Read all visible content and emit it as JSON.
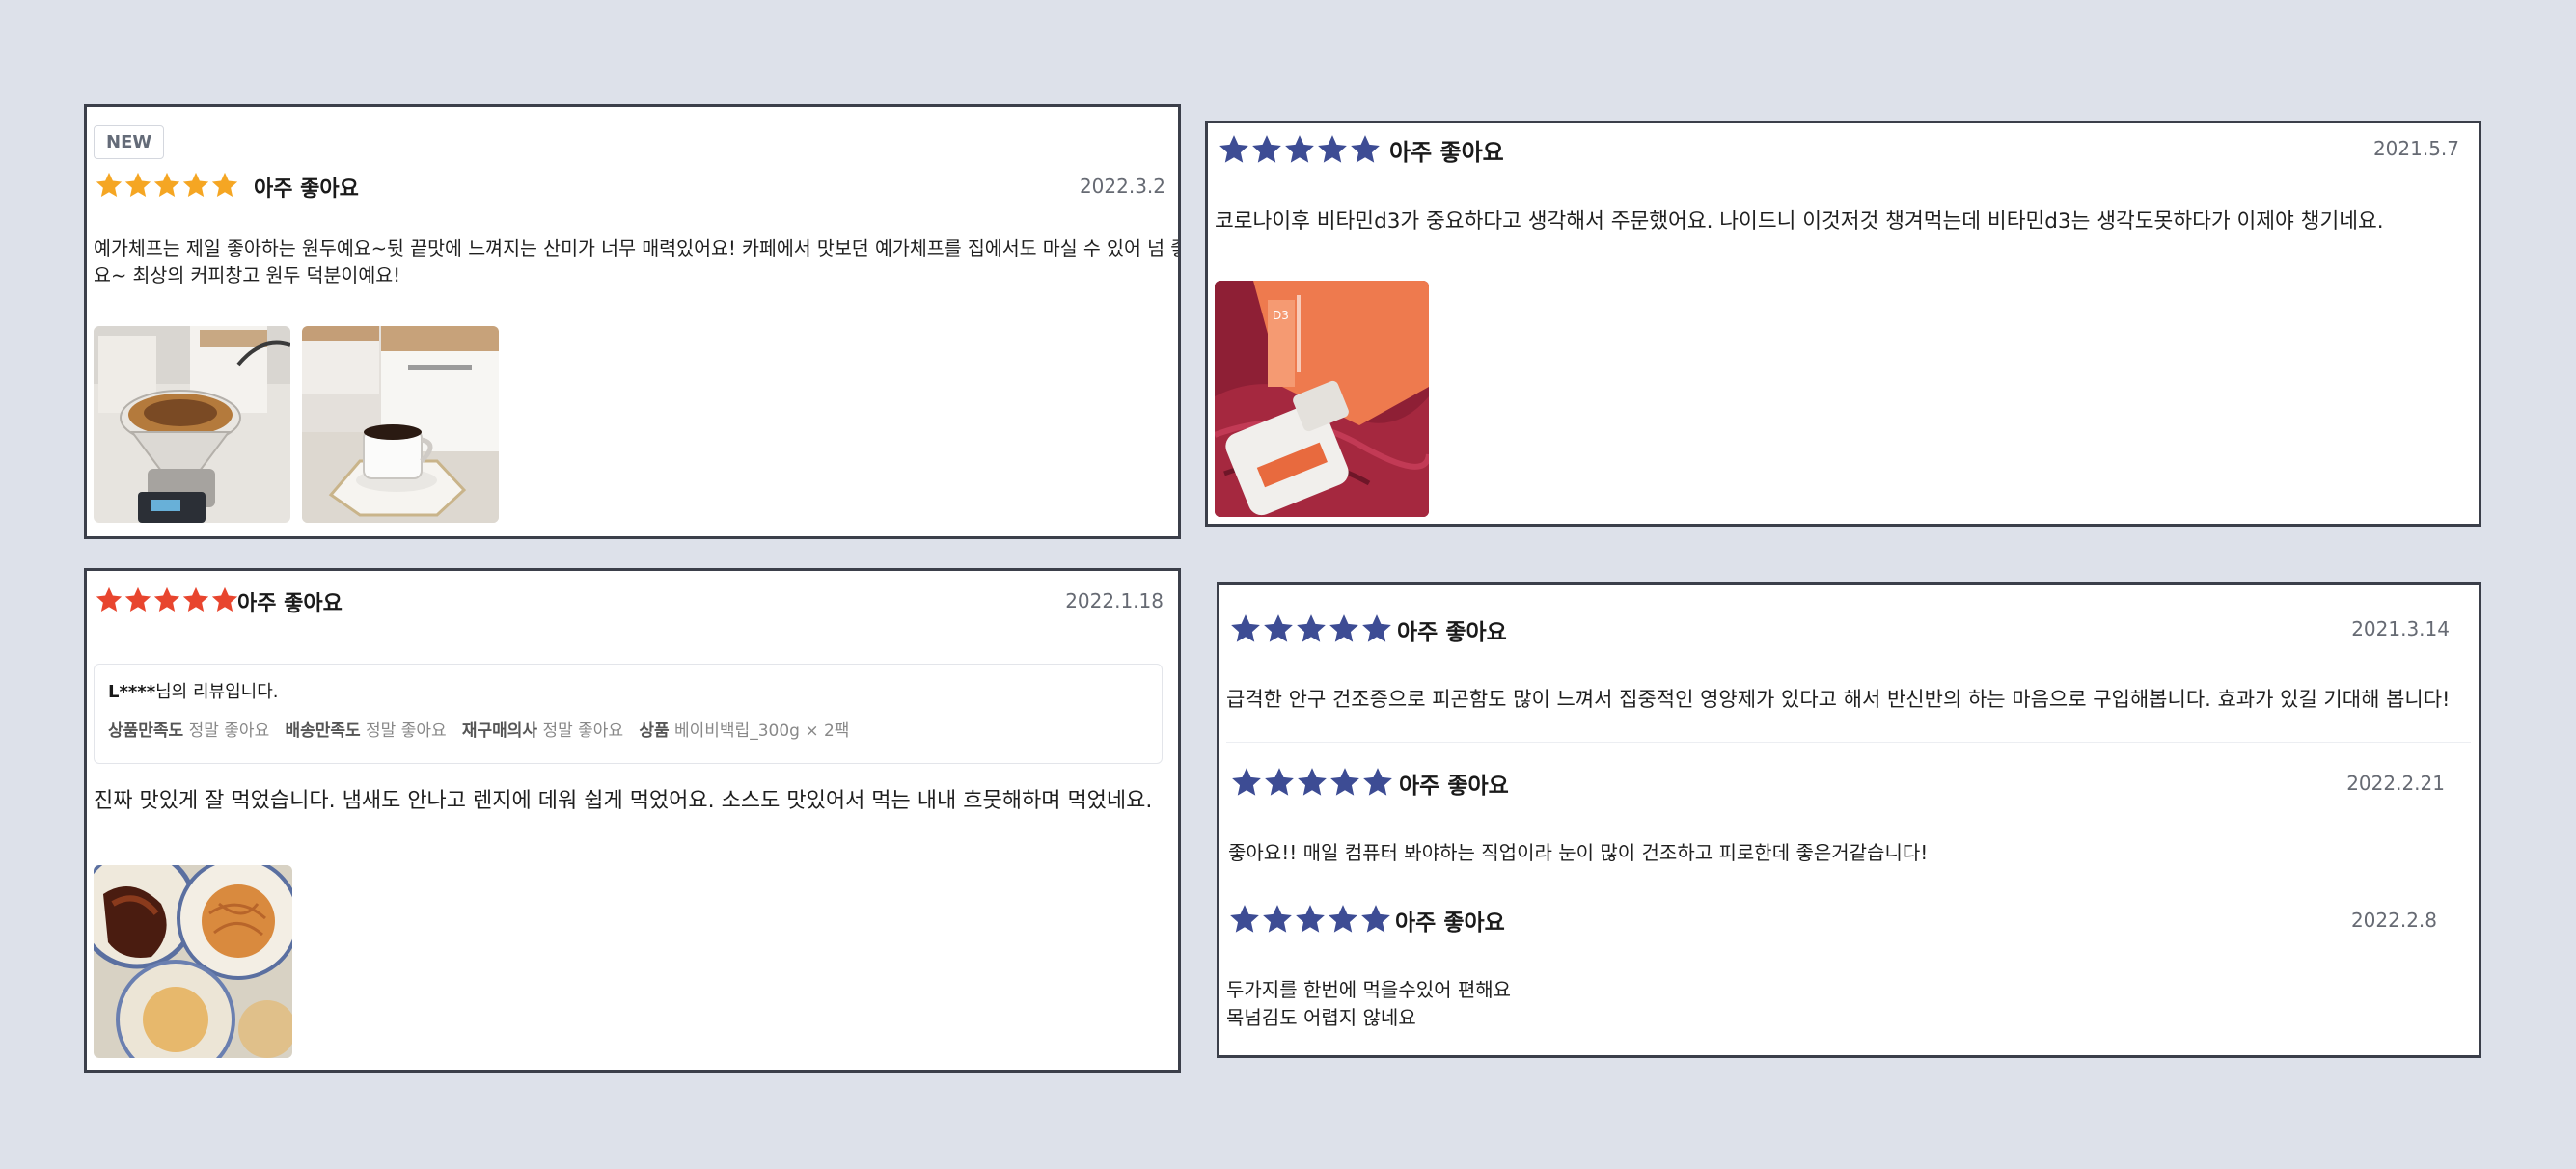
{
  "colors": {
    "background": "#dde1ea",
    "star_orange": "#f5a623",
    "star_red": "#e8452e",
    "star_navy": "#3d4c94"
  },
  "reviews": {
    "r1": {
      "badge": "NEW",
      "rating": 5,
      "title": "아주 좋아요",
      "date": "2022.3.2",
      "text_line1": "예가체프는 제일 좋아하는 원두예요~뒷 끝맛에 느껴지는 산미가 너무 매력있어요! 카페에서 맛보던 예가체프를 집에서도 마실 수 있어 넘 좋네",
      "text_line2": "요~ 최상의 커피창고 원두 덕분이예요!",
      "photos": [
        "coffee-dripper-photo",
        "coffee-cup-photo"
      ]
    },
    "r2": {
      "rating": 5,
      "title": "아주 좋아요",
      "date": "2021.5.7",
      "text": "코로나이후 비타민d3가 중요하다고 생각해서 주문했어요. 나이드니 이것저것 챙겨먹는데 비타민d3는 생각도못하다가 이제야 챙기네요.",
      "photos": [
        "vitamin-box-photo"
      ]
    },
    "r3": {
      "rating": 5,
      "title": "아주 좋아요",
      "date": "2022.1.18",
      "reviewer_name": "L****",
      "reviewer_suffix": "님의 리뷰입니다.",
      "details": [
        {
          "label": "상품만족도",
          "value": "정말 좋아요"
        },
        {
          "label": "배송만족도",
          "value": "정말 좋아요"
        },
        {
          "label": "재구매의사",
          "value": "정말 좋아요"
        },
        {
          "label": "상품",
          "value": "베이비백립_300g × 2팩"
        }
      ],
      "text": "진짜 맛있게 잘 먹었습니다. 냄새도 안나고 렌지에 데워 쉽게 먹었어요. 소스도 맛있어서 먹는 내내 흐뭇해하며 먹었네요.",
      "photos": [
        "ribs-pasta-photo"
      ]
    },
    "r4": {
      "rating": 5,
      "title": "아주 좋아요",
      "date": "2021.3.14",
      "text": "급격한 안구 건조증으로 피곤함도 많이 느껴서 집중적인 영양제가 있다고 해서 반신반의 하는 마음으로 구입해봅니다. 효과가 있길 기대해 봅니다!"
    },
    "r5": {
      "rating": 5,
      "title": "아주 좋아요",
      "date": "2022.2.21",
      "text": "좋아요!! 매일 컴퓨터 봐야하는 직업이라 눈이 많이 건조하고 피로한데 좋은거같습니다!"
    },
    "r6": {
      "rating": 5,
      "title": "아주 좋아요",
      "date": "2022.2.8",
      "text_line1": "두가지를 한번에 먹을수있어 편해요",
      "text_line2": "목넘김도 어렵지 않네요"
    }
  }
}
